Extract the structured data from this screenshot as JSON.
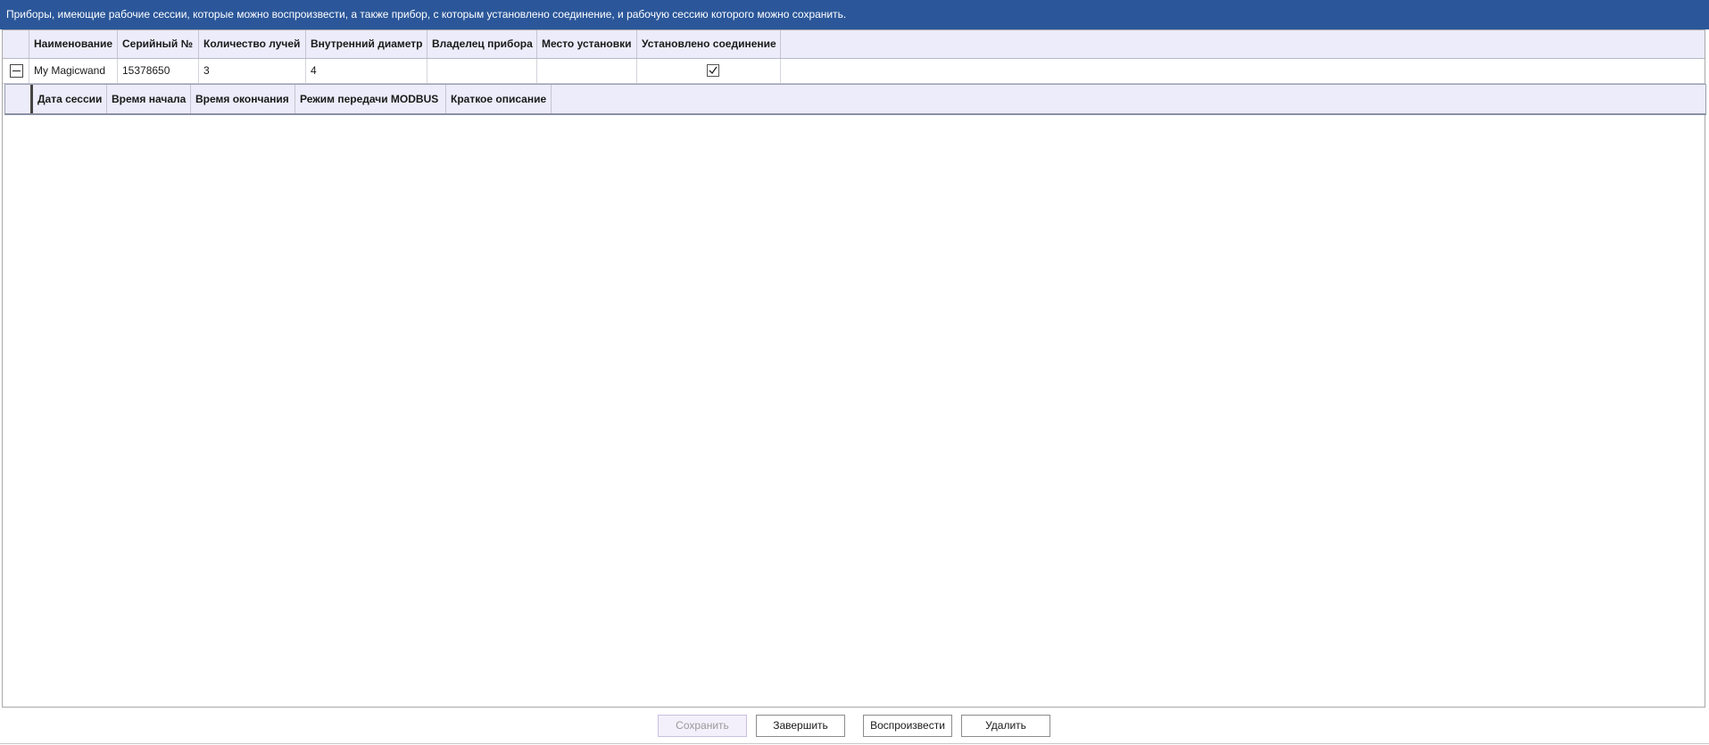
{
  "header": {
    "title": "Приборы, имеющие рабочие сессии, которые можно воспроизвести, а также прибор, с которым установлено соединение, и рабочую сессию которого можно сохранить."
  },
  "devices_table": {
    "columns": [
      "Наименование",
      "Серийный №",
      "Количество лучей",
      "Внутренний диаметр",
      "Владелец прибора",
      "Место установки",
      "Установлено соединение"
    ],
    "rows": [
      {
        "name": "My Magicwand",
        "serial": "15378650",
        "beams": "3",
        "inner_diameter": "4",
        "owner": "",
        "location": "",
        "connected": true
      }
    ]
  },
  "sessions_table": {
    "columns": [
      "Дата сессии",
      "Время начала",
      "Время окончания",
      "Режим передачи MODBUS",
      "Краткое описание"
    ]
  },
  "buttons": {
    "save": "Сохранить",
    "finish": "Завершить",
    "play": "Воспроизвести",
    "delete": "Удалить"
  }
}
